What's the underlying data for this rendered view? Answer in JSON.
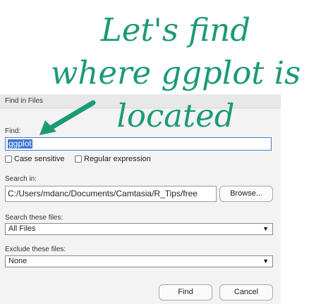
{
  "annotation": {
    "line1": "Let's find",
    "line2": "where ggplot is",
    "line3": "located",
    "color": "#1c9a76"
  },
  "dialog": {
    "title": "Find in Files",
    "find_label": "Find:",
    "find_value": "ggplot",
    "case_sensitive_label": "Case sensitive",
    "case_sensitive_checked": false,
    "regex_label": "Regular expression",
    "regex_checked": false,
    "search_in_label": "Search in:",
    "search_in_value": "C:/Users/mdanc/Documents/Camtasia/R_Tips/free",
    "browse_label": "Browse...",
    "search_files_label": "Search these files:",
    "search_files_value": "All Files",
    "exclude_files_label": "Exclude these files:",
    "exclude_files_value": "None",
    "find_button": "Find",
    "cancel_button": "Cancel",
    "selection_color": "#3f72d4"
  },
  "icons": {
    "annotation_arrow": "arrow-pointing-down-left-icon",
    "dropdown": "dropdown-triangle-icon"
  }
}
